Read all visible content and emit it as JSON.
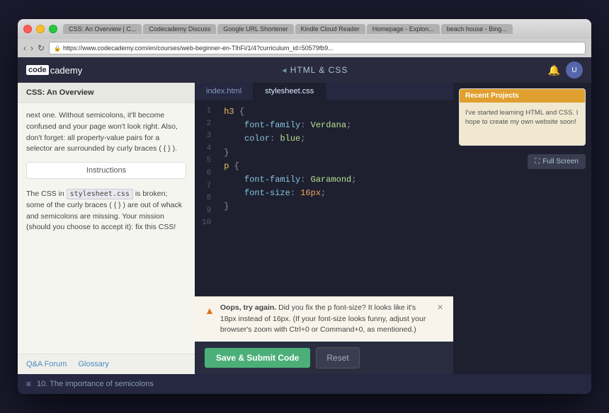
{
  "window": {
    "tabs": [
      {
        "label": "CSS: An Overview | C...",
        "active": false
      },
      {
        "label": "Codecademy Discuss",
        "active": false
      },
      {
        "label": "Google URL Shortener",
        "active": false
      },
      {
        "label": "Kindle Cloud Reader",
        "active": false
      },
      {
        "label": "Homepage - Explon...",
        "active": false
      },
      {
        "label": "beach house - Bing...",
        "active": false
      }
    ],
    "address": "https://www.codecademy.com/en/courses/web-beginner-en-TlhFi/1/4?curriculum_id=50579fb9..."
  },
  "app": {
    "logo_code": "code",
    "logo_academy": "cademy",
    "title": "HTML & CSS",
    "bell_icon": "🔔",
    "avatar_label": "U"
  },
  "left_panel": {
    "lesson_title": "CSS: An Overview",
    "lesson_text": "next one. Without semicolons, it'll become confused and your page won't look right.\n\nAlso, don't forget: all property-value pairs for a selector are surrounded by curly braces ( { } ).",
    "instructions_tab_label": "Instructions",
    "instructions_text_pre": "The CSS in",
    "instructions_code": "stylesheet.css",
    "instructions_text_post": "is broken; some of the curly braces ( { } ) are out of whack and semicolons are missing. Your mission (should you choose to accept it): fix this CSS!",
    "footer_qa": "Q&A Forum",
    "footer_glossary": "Glossary"
  },
  "editor": {
    "tabs": [
      {
        "label": "index.html",
        "active": false
      },
      {
        "label": "stylesheet.css",
        "active": true
      }
    ],
    "lines": [
      {
        "num": "1",
        "content": "h3 {",
        "type": "selector-open"
      },
      {
        "num": "2",
        "content": "    font-family: Verdana;",
        "type": "property"
      },
      {
        "num": "3",
        "content": "    color: blue;",
        "type": "property"
      },
      {
        "num": "4",
        "content": "}",
        "type": "close"
      },
      {
        "num": "5",
        "content": "",
        "type": "blank"
      },
      {
        "num": "6",
        "content": "p {",
        "type": "selector-open"
      },
      {
        "num": "7",
        "content": "    font-family: Garamond;",
        "type": "property"
      },
      {
        "num": "8",
        "content": "    font-size: 16px;",
        "type": "property"
      },
      {
        "num": "9",
        "content": "}",
        "type": "close"
      },
      {
        "num": "10",
        "content": "",
        "type": "blank"
      }
    ]
  },
  "feedback": {
    "warning_icon": "▲",
    "bold_text": "Oops, try again.",
    "message": " Did you fix the p font-size? It looks like it's 18px instead of 16px. (If your font-size looks funny, adjust your browser's zoom with Ctrl+0 or Command+0, as mentioned.)",
    "close_icon": "✕"
  },
  "actions": {
    "submit_label": "Save & Submit Code",
    "reset_label": "Reset"
  },
  "right_panel": {
    "recent_projects_title": "Recent Projects",
    "recent_projects_text": "I've started learning HTML and CSS. I hope to create my own website soon!",
    "fullscreen_icon": "⛶",
    "fullscreen_label": "Full Screen"
  },
  "bottom_bar": {
    "hamburger": "≡",
    "lesson_label": "10. The importance of semicolons"
  }
}
